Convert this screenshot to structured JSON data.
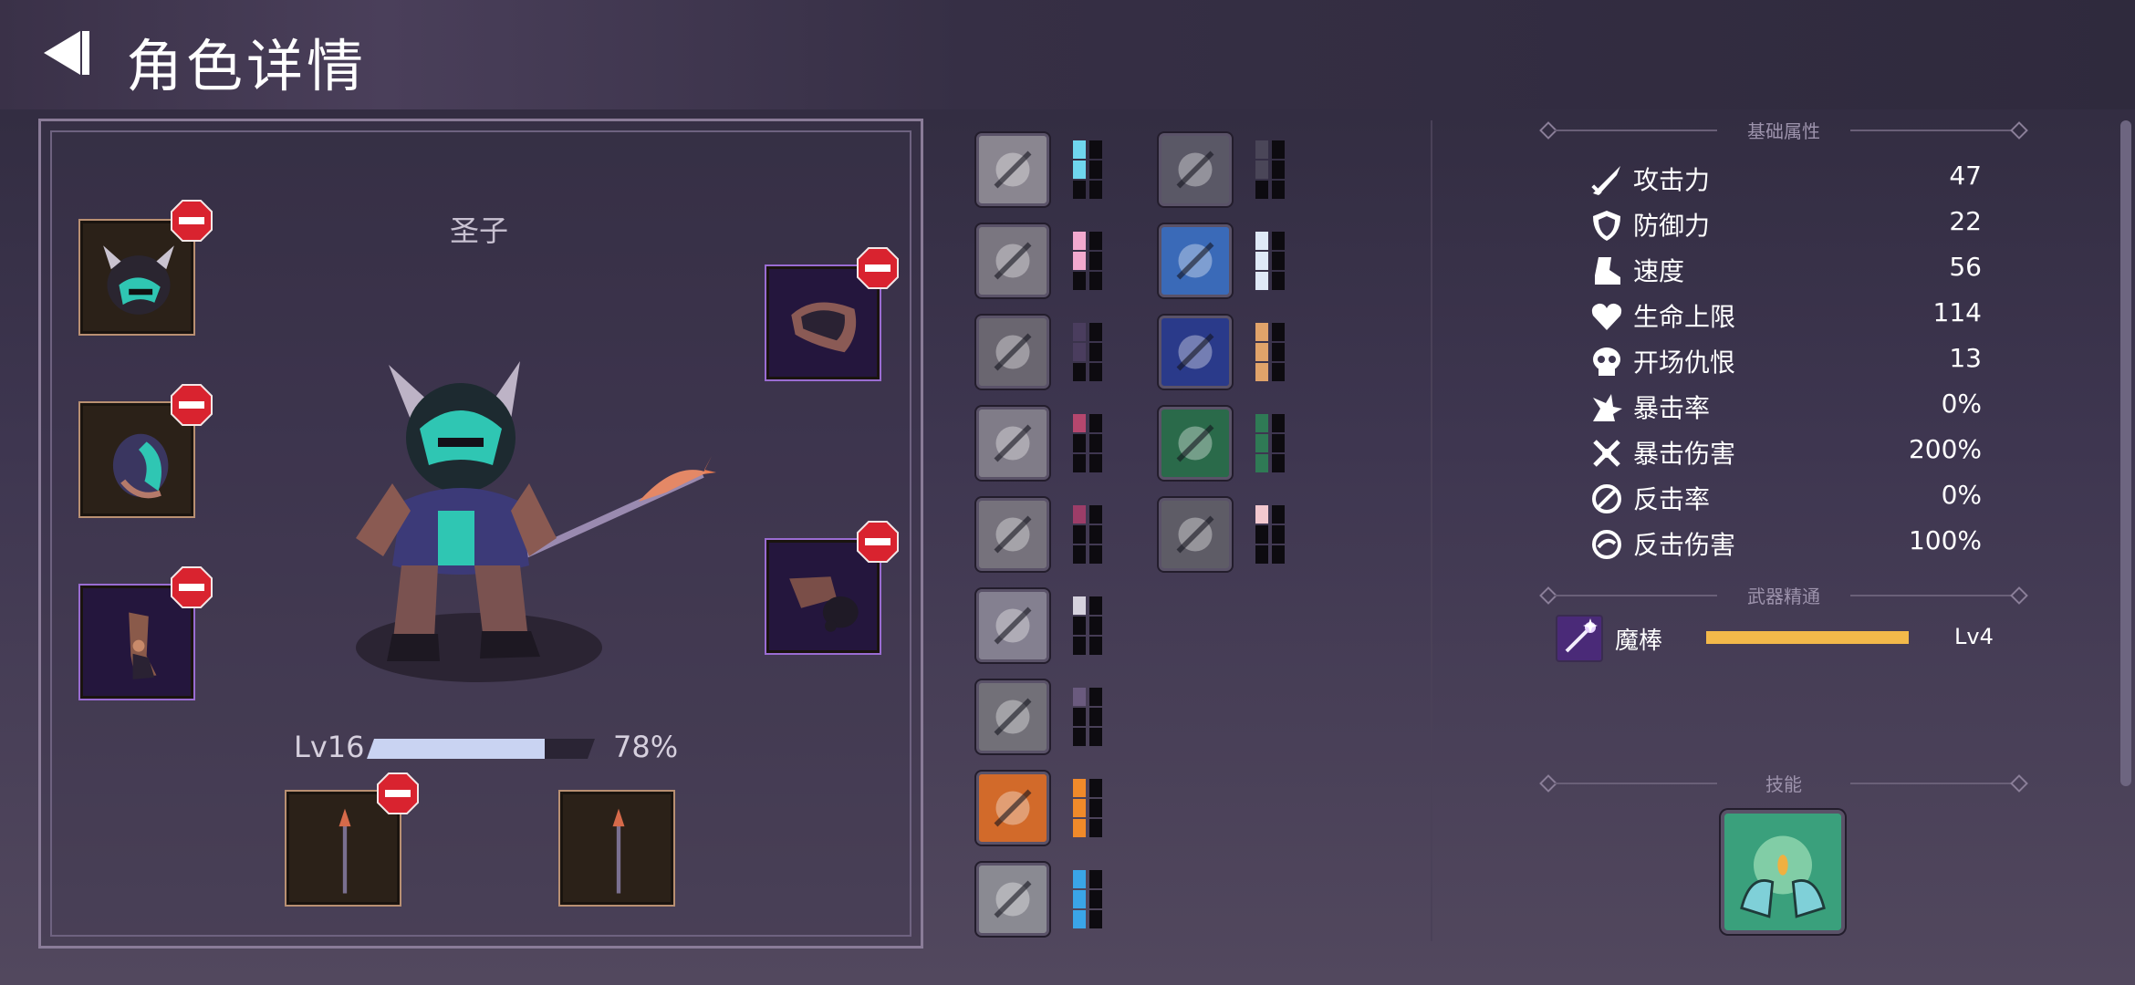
{
  "header": {
    "title": "角色详情",
    "back_icon": "back-arrow-icon"
  },
  "character": {
    "name": "圣子",
    "level_label": "Lv16",
    "xp_percent_label": "78%",
    "xp_fraction": 0.78
  },
  "equipment": [
    {
      "slot": "head",
      "icon": "horned-helmet-icon",
      "rarity": "common"
    },
    {
      "slot": "head-2",
      "icon": "teal-helmet-icon",
      "rarity": "common"
    },
    {
      "slot": "legs",
      "icon": "leg-armor-icon",
      "rarity": "epic"
    },
    {
      "slot": "shoulder",
      "icon": "shoulder-armor-icon",
      "rarity": "epic"
    },
    {
      "slot": "hands",
      "icon": "gauntlet-icon",
      "rarity": "epic"
    },
    {
      "slot": "weapon",
      "icon": "spear-icon",
      "rarity": "common"
    },
    {
      "slot": "offhand",
      "icon": "spear-icon",
      "rarity": "common"
    }
  ],
  "talents": [
    {
      "icon": "raised-fist-icon",
      "pip_color": "#6fd6ee",
      "filled": 2
    },
    {
      "icon": "boot-icon",
      "pip_color": "#f2a9cf",
      "filled": 2
    },
    {
      "icon": "ghost-head-icon",
      "pip_color": "#4a3d5e",
      "filled": 2
    },
    {
      "icon": "claw-slash-icon",
      "pip_color": "#b5476e",
      "filled": 1
    },
    {
      "icon": "crossed-blades-icon",
      "pip_color": "#9c3d68",
      "filled": 1
    },
    {
      "icon": "battle-axe-icon",
      "pip_color": "#d6d2de",
      "filled": 1
    },
    {
      "icon": "shield-bearer-icon",
      "pip_color": "#6a5a7e",
      "filled": 1
    },
    {
      "icon": "fire-hand-icon",
      "pip_color": "#f08a2a",
      "filled": 3
    },
    {
      "icon": "mace-icon",
      "pip_color": "#3aa5e8",
      "filled": 3
    },
    {
      "icon": "wind-slash-icon",
      "pip_color": "#4a4658",
      "filled": 2
    },
    {
      "icon": "winged-shield-icon",
      "pip_color": "#dfe9f7",
      "filled": 3
    },
    {
      "icon": "light-orb-icon",
      "pip_color": "#e0a36a",
      "filled": 3
    },
    {
      "icon": "forest-banner-icon",
      "pip_color": "#2f7a55",
      "filled": 3
    },
    {
      "icon": "twin-sabers-icon",
      "pip_color": "#f3c8cf",
      "filled": 1
    }
  ],
  "stats": {
    "section_label": "基础属性",
    "rows": [
      {
        "icon": "sword-icon",
        "name": "攻击力",
        "value": "47"
      },
      {
        "icon": "shield-icon",
        "name": "防御力",
        "value": "22"
      },
      {
        "icon": "speed-boot-icon",
        "name": "速度",
        "value": "56"
      },
      {
        "icon": "heart-icon",
        "name": "生命上限",
        "value": "114"
      },
      {
        "icon": "skull-icon",
        "name": "开场仇恨",
        "value": "13"
      },
      {
        "icon": "crit-burst-icon",
        "name": "暴击率",
        "value": "0%"
      },
      {
        "icon": "crit-damage-icon",
        "name": "暴击伤害",
        "value": "200%"
      },
      {
        "icon": "counter-icon",
        "name": "反击率",
        "value": "0%"
      },
      {
        "icon": "counter-damage-icon",
        "name": "反击伤害",
        "value": "100%"
      }
    ]
  },
  "weapon_mastery": {
    "section_label": "武器精通",
    "icon": "magic-wand-icon",
    "name": "魔棒",
    "level": "Lv4",
    "progress": 1.0
  },
  "skills": {
    "section_label": "技能",
    "icon": "healing-hands-icon"
  },
  "colors": {
    "common_slot": "#b99072",
    "epic_slot": "#9a6cd2",
    "remove": "#d9232f",
    "mastery_bar": "#f3b94a"
  }
}
